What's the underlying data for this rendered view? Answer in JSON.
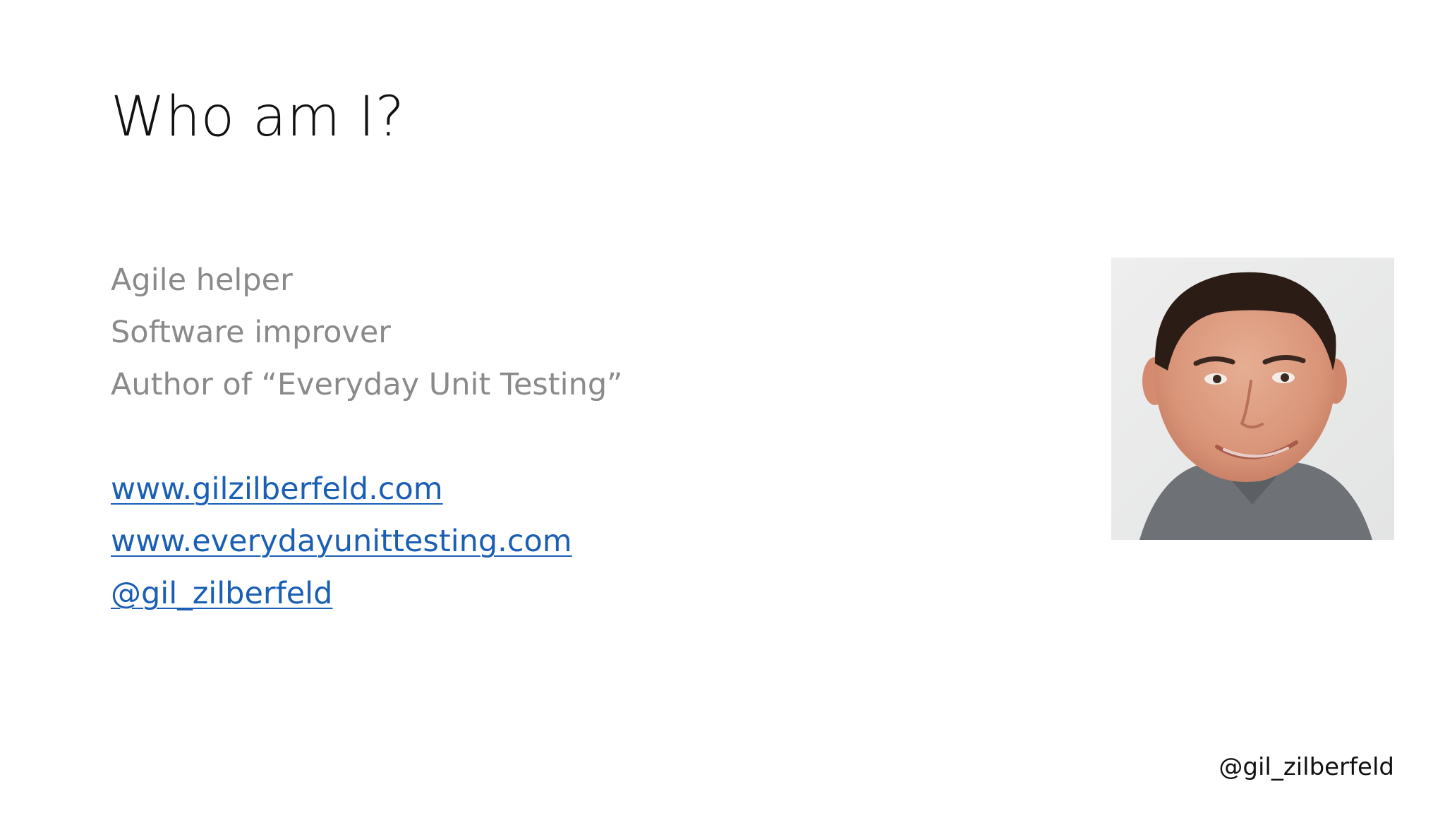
{
  "slide": {
    "title": "Who am I?",
    "description_lines": [
      "Agile helper",
      "Software improver",
      "Author of “Everyday Unit Testing”"
    ],
    "links": [
      "www.gilzilberfeld.com",
      "www.everydayunittesting.com",
      "@gil_zilberfeld"
    ],
    "photo": {
      "icon": "portrait-photo"
    },
    "footer_handle": "@gil_zilberfeld"
  },
  "colors": {
    "title": "#111111",
    "body_text": "#8a8a8a",
    "link": "#1a5fb4",
    "background": "#ffffff"
  }
}
